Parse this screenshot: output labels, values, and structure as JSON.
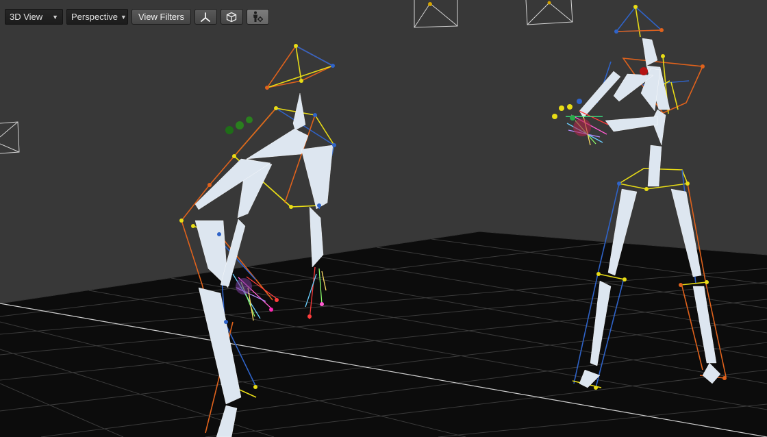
{
  "toolbar": {
    "view_mode": "3D View",
    "projection": "Perspective",
    "view_filters_label": "View Filters",
    "icons": [
      "axes-icon",
      "cube-icon",
      "skeleton-settings-icon"
    ]
  },
  "colors": {
    "background": "#3a3a3a",
    "floor": "#0c0c0c",
    "grid": "#3e3e3e",
    "bone": "#dde6f0",
    "marker_blue": "#2f63c8",
    "marker_orange": "#e0621c",
    "marker_yellow": "#e8dc16"
  }
}
